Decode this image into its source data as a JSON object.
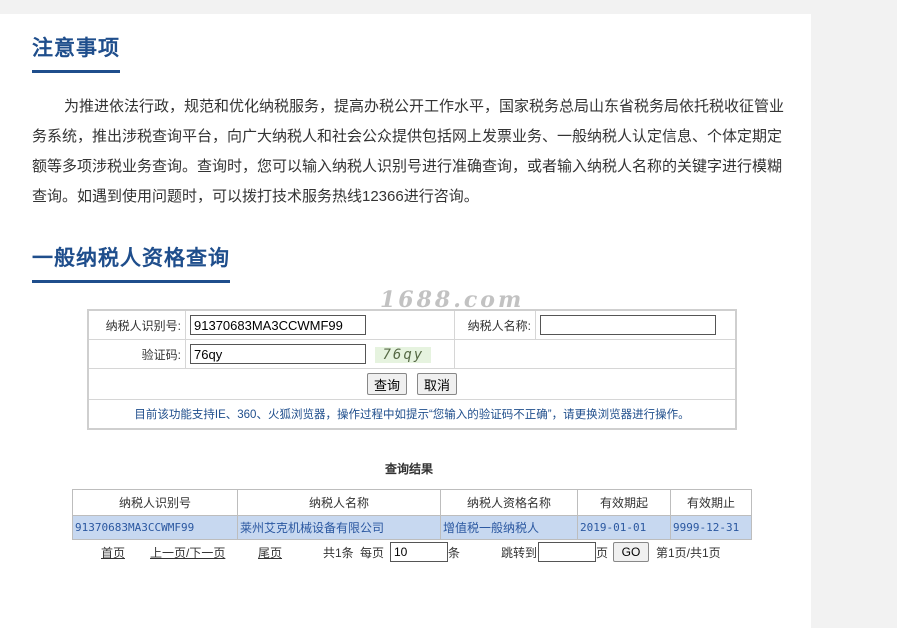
{
  "notice": {
    "title": "注意事项",
    "body": "为推进依法行政，规范和优化纳税服务，提高办税公开工作水平，国家税务总局山东省税务局依托税收征管业务系统，推出涉税查询平台，向广大纳税人和社会公众提供包括网上发票业务、一般纳税人认定信息、个体定期定额等多项涉税业务查询。查询时，您可以输入纳税人识别号进行准确查询，或者输入纳税人名称的关键字进行模糊查询。如遇到使用问题时，可以拨打技术服务热线12366进行咨询。"
  },
  "query": {
    "title": "一般纳税人资格查询",
    "watermark": "1688.com",
    "taxpayer_id_label": "纳税人识别号:",
    "taxpayer_id_value": "91370683MA3CCWMF99",
    "taxpayer_name_label": "纳税人名称:",
    "taxpayer_name_value": "",
    "captcha_label": "验证码:",
    "captcha_value": "76qy",
    "captcha_image_text": "76qy",
    "search_button": "查询",
    "cancel_button": "取消",
    "hint": "目前该功能支持IE、360、火狐浏览器，操作过程中如提示“您输入的验证码不正确”，请更换浏览器进行操作。"
  },
  "result": {
    "title": "查询结果",
    "columns": [
      "纳税人识别号",
      "纳税人名称",
      "纳税人资格名称",
      "有效期起",
      "有效期止"
    ],
    "rows": [
      [
        "91370683MA3CCWMF99",
        "莱州艾克机械设备有限公司",
        "增值税一般纳税人",
        "2019-01-01",
        "9999-12-31"
      ]
    ]
  },
  "pager": {
    "first": "首页",
    "prev_next": "上一页/下一页",
    "last": "尾页",
    "total": "共1条",
    "per_page_label": "每页",
    "per_page_value": "10",
    "per_page_unit": "条",
    "jump_label": "跳转到",
    "jump_value": "",
    "page_unit": "页",
    "go_button": "GO",
    "page_info": "第1页/共1页"
  }
}
